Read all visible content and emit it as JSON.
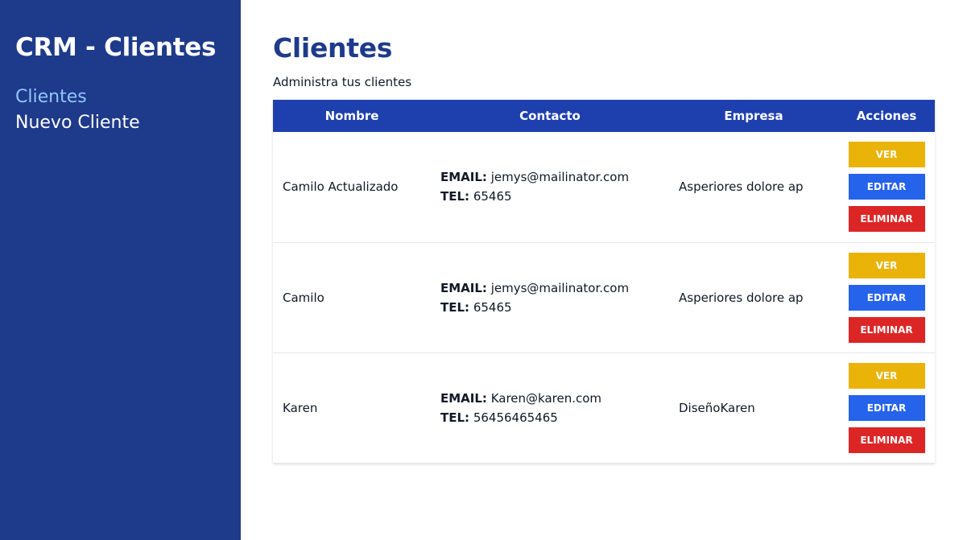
{
  "sidebar": {
    "brand": "CRM - Clientes",
    "nav": [
      {
        "label": "Clientes",
        "active": true
      },
      {
        "label": "Nuevo Cliente",
        "active": false
      }
    ]
  },
  "main": {
    "title": "Clientes",
    "subtitle": "Administra tus clientes"
  },
  "table": {
    "headers": [
      "Nombre",
      "Contacto",
      "Empresa",
      "Acciones"
    ],
    "email_label": "EMAIL:",
    "tel_label": "TEL:",
    "buttons": {
      "view": "Ver",
      "edit": "Editar",
      "delete": "Eliminar"
    },
    "rows": [
      {
        "name": "Camilo Actualizado",
        "email": "jemys@mailinator.com",
        "tel": "65465",
        "company": "Asperiores dolore ap"
      },
      {
        "name": "Camilo",
        "email": "jemys@mailinator.com",
        "tel": "65465",
        "company": "Asperiores dolore ap"
      },
      {
        "name": "Karen",
        "email": "Karen@karen.com",
        "tel": "56456465465",
        "company": "DiseñoKaren"
      }
    ]
  },
  "colors": {
    "sidebar_bg": "#1e3a8a",
    "header_bg": "#1e40af",
    "active_link": "#93c5fd",
    "view_button": "#eab308",
    "edit_button": "#2563eb",
    "delete_button": "#dc2626"
  }
}
